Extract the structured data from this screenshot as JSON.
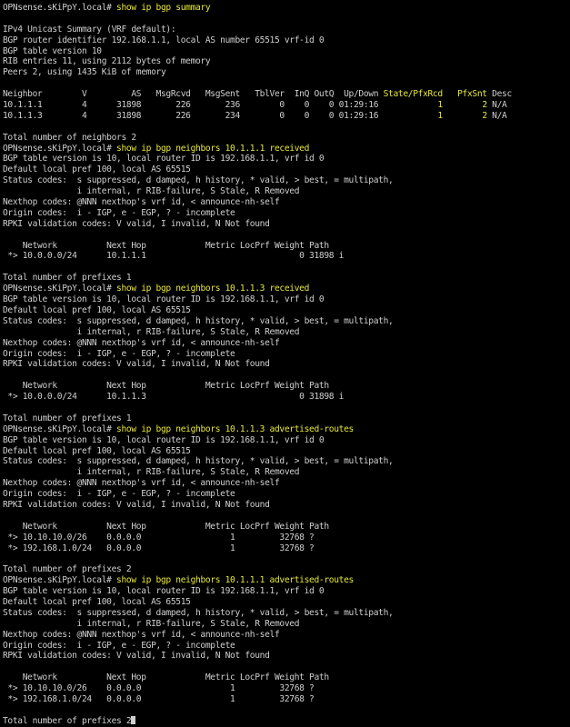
{
  "colors": {
    "background": "#000000",
    "text": "#cfcfcf",
    "highlight": "#e8e838"
  },
  "lines": [
    {
      "segs": [
        {
          "t": "OPNsense.sKiPpY.local# "
        },
        {
          "t": "show ip bgp summary",
          "h": true
        }
      ]
    },
    {
      "segs": [
        {
          "t": ""
        }
      ]
    },
    {
      "segs": [
        {
          "t": "IPv4 Unicast Summary (VRF default):"
        }
      ]
    },
    {
      "segs": [
        {
          "t": "BGP router identifier 192.168.1.1, local AS number 65515 vrf-id 0"
        }
      ]
    },
    {
      "segs": [
        {
          "t": "BGP table version 10"
        }
      ]
    },
    {
      "segs": [
        {
          "t": "RIB entries 11, using 2112 bytes of memory"
        }
      ]
    },
    {
      "segs": [
        {
          "t": "Peers 2, using 1435 KiB of memory"
        }
      ]
    },
    {
      "segs": [
        {
          "t": ""
        }
      ]
    },
    {
      "segs": [
        {
          "t": "Neighbor        V         AS   MsgRcvd   MsgSent   TblVer  InQ OutQ  Up/Down "
        },
        {
          "t": "State/PfxRcd",
          "h": true
        },
        {
          "t": "   "
        },
        {
          "t": "PfxSnt",
          "h": true
        },
        {
          "t": " Desc"
        }
      ]
    },
    {
      "segs": [
        {
          "t": "10.1.1.1        4      31898       226       236        0    0    0 01:29:16            "
        },
        {
          "t": "1",
          "h": true
        },
        {
          "t": "        "
        },
        {
          "t": "2",
          "h": true
        },
        {
          "t": " N/A"
        }
      ]
    },
    {
      "segs": [
        {
          "t": "10.1.1.3        4      31898       226       234        0    0    0 01:29:16            "
        },
        {
          "t": "1",
          "h": true
        },
        {
          "t": "        "
        },
        {
          "t": "2",
          "h": true
        },
        {
          "t": " N/A"
        }
      ]
    },
    {
      "segs": [
        {
          "t": ""
        }
      ]
    },
    {
      "segs": [
        {
          "t": "Total number of neighbors 2"
        }
      ]
    },
    {
      "segs": [
        {
          "t": "OPNsense.sKiPpY.local# "
        },
        {
          "t": "show ip bgp neighbors 10.1.1.1 received",
          "h": true
        }
      ]
    },
    {
      "segs": [
        {
          "t": "BGP table version is 10, local router ID is 192.168.1.1, vrf id 0"
        }
      ]
    },
    {
      "segs": [
        {
          "t": "Default local pref 100, local AS 65515"
        }
      ]
    },
    {
      "segs": [
        {
          "t": "Status codes:  s suppressed, d damped, h history, * valid, > best, = multipath,"
        }
      ]
    },
    {
      "segs": [
        {
          "t": "               i internal, r RIB-failure, S Stale, R Removed"
        }
      ]
    },
    {
      "segs": [
        {
          "t": "Nexthop codes: @NNN nexthop's vrf id, < announce-nh-self"
        }
      ]
    },
    {
      "segs": [
        {
          "t": "Origin codes:  i - IGP, e - EGP, ? - incomplete"
        }
      ]
    },
    {
      "segs": [
        {
          "t": "RPKI validation codes: V valid, I invalid, N Not found"
        }
      ]
    },
    {
      "segs": [
        {
          "t": ""
        }
      ]
    },
    {
      "segs": [
        {
          "t": "    Network          Next Hop            Metric LocPrf Weight Path"
        }
      ]
    },
    {
      "segs": [
        {
          "t": " *> 10.0.0.0/24      10.1.1.1                               0 31898 i"
        }
      ]
    },
    {
      "segs": [
        {
          "t": ""
        }
      ]
    },
    {
      "segs": [
        {
          "t": "Total number of prefixes 1"
        }
      ]
    },
    {
      "segs": [
        {
          "t": "OPNsense.sKiPpY.local# "
        },
        {
          "t": "show ip bgp neighbors 10.1.1.3 received",
          "h": true
        }
      ]
    },
    {
      "segs": [
        {
          "t": "BGP table version is 10, local router ID is 192.168.1.1, vrf id 0"
        }
      ]
    },
    {
      "segs": [
        {
          "t": "Default local pref 100, local AS 65515"
        }
      ]
    },
    {
      "segs": [
        {
          "t": "Status codes:  s suppressed, d damped, h history, * valid, > best, = multipath,"
        }
      ]
    },
    {
      "segs": [
        {
          "t": "               i internal, r RIB-failure, S Stale, R Removed"
        }
      ]
    },
    {
      "segs": [
        {
          "t": "Nexthop codes: @NNN nexthop's vrf id, < announce-nh-self"
        }
      ]
    },
    {
      "segs": [
        {
          "t": "Origin codes:  i - IGP, e - EGP, ? - incomplete"
        }
      ]
    },
    {
      "segs": [
        {
          "t": "RPKI validation codes: V valid, I invalid, N Not found"
        }
      ]
    },
    {
      "segs": [
        {
          "t": ""
        }
      ]
    },
    {
      "segs": [
        {
          "t": "    Network          Next Hop            Metric LocPrf Weight Path"
        }
      ]
    },
    {
      "segs": [
        {
          "t": " *> 10.0.0.0/24      10.1.1.3                               0 31898 i"
        }
      ]
    },
    {
      "segs": [
        {
          "t": ""
        }
      ]
    },
    {
      "segs": [
        {
          "t": "Total number of prefixes 1"
        }
      ]
    },
    {
      "segs": [
        {
          "t": "OPNsense.sKiPpY.local# "
        },
        {
          "t": "show ip bgp neighbors 10.1.1.3 advertised-routes",
          "h": true
        }
      ]
    },
    {
      "segs": [
        {
          "t": "BGP table version is 10, local router ID is 192.168.1.1, vrf id 0"
        }
      ]
    },
    {
      "segs": [
        {
          "t": "Default local pref 100, local AS 65515"
        }
      ]
    },
    {
      "segs": [
        {
          "t": "Status codes:  s suppressed, d damped, h history, * valid, > best, = multipath,"
        }
      ]
    },
    {
      "segs": [
        {
          "t": "               i internal, r RIB-failure, S Stale, R Removed"
        }
      ]
    },
    {
      "segs": [
        {
          "t": "Nexthop codes: @NNN nexthop's vrf id, < announce-nh-self"
        }
      ]
    },
    {
      "segs": [
        {
          "t": "Origin codes:  i - IGP, e - EGP, ? - incomplete"
        }
      ]
    },
    {
      "segs": [
        {
          "t": "RPKI validation codes: V valid, I invalid, N Not found"
        }
      ]
    },
    {
      "segs": [
        {
          "t": ""
        }
      ]
    },
    {
      "segs": [
        {
          "t": "    Network          Next Hop            Metric LocPrf Weight Path"
        }
      ]
    },
    {
      "segs": [
        {
          "t": " *> 10.10.10.0/26    0.0.0.0                  1         32768 ?"
        }
      ]
    },
    {
      "segs": [
        {
          "t": " *> 192.168.1.0/24   0.0.0.0                  1         32768 ?"
        }
      ]
    },
    {
      "segs": [
        {
          "t": ""
        }
      ]
    },
    {
      "segs": [
        {
          "t": "Total number of prefixes 2"
        }
      ]
    },
    {
      "segs": [
        {
          "t": "OPNsense.sKiPpY.local# "
        },
        {
          "t": "show ip bgp neighbors 10.1.1.1 advertised-routes",
          "h": true
        }
      ]
    },
    {
      "segs": [
        {
          "t": "BGP table version is 10, local router ID is 192.168.1.1, vrf id 0"
        }
      ]
    },
    {
      "segs": [
        {
          "t": "Default local pref 100, local AS 65515"
        }
      ]
    },
    {
      "segs": [
        {
          "t": "Status codes:  s suppressed, d damped, h history, * valid, > best, = multipath,"
        }
      ]
    },
    {
      "segs": [
        {
          "t": "               i internal, r RIB-failure, S Stale, R Removed"
        }
      ]
    },
    {
      "segs": [
        {
          "t": "Nexthop codes: @NNN nexthop's vrf id, < announce-nh-self"
        }
      ]
    },
    {
      "segs": [
        {
          "t": "Origin codes:  i - IGP, e - EGP, ? - incomplete"
        }
      ]
    },
    {
      "segs": [
        {
          "t": "RPKI validation codes: V valid, I invalid, N Not found"
        }
      ]
    },
    {
      "segs": [
        {
          "t": ""
        }
      ]
    },
    {
      "segs": [
        {
          "t": "    Network          Next Hop            Metric LocPrf Weight Path"
        }
      ]
    },
    {
      "segs": [
        {
          "t": " *> 10.10.10.0/26    0.0.0.0                  1         32768 ?"
        }
      ]
    },
    {
      "segs": [
        {
          "t": " *> 192.168.1.0/24   0.0.0.0                  1         32768 ?"
        }
      ]
    },
    {
      "segs": [
        {
          "t": ""
        }
      ]
    },
    {
      "segs": [
        {
          "t": "Total number of prefixes 2"
        },
        {
          "cursor": true
        }
      ]
    }
  ]
}
